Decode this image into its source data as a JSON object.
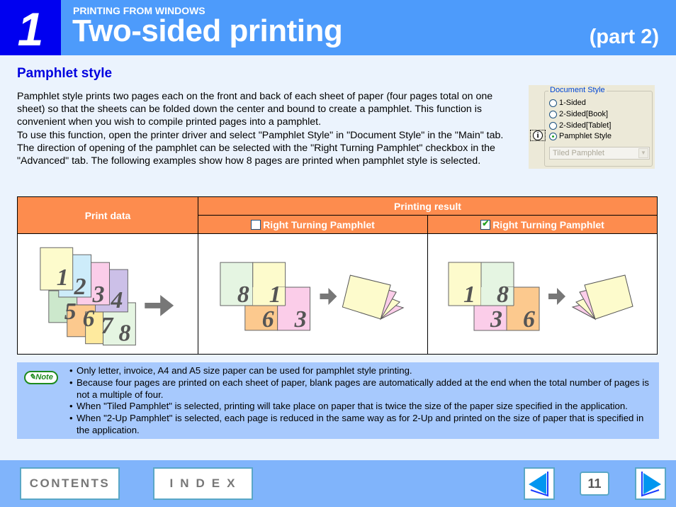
{
  "header": {
    "chapter_number": "1",
    "section_label": "PRINTING FROM WINDOWS",
    "title": "Two-sided printing",
    "part_label": "(part 2)"
  },
  "section": {
    "heading": "Pamphlet style",
    "paragraphs": [
      "Pamphlet style prints two pages each on the front and back of each sheet of paper (four pages total on one sheet) so that the sheets can be folded down the center and bound to create a pamphlet. This function is convenient when you wish to compile printed pages into a pamphlet.",
      "To use this function, open the printer driver and select \"Pamphlet Style\" in \"Document Style\" in the \"Main\" tab.",
      "The direction of opening of the pamphlet can be selected with the \"Right Turning Pamphlet\" checkbox in the \"Advanced\" tab. The following examples show how 8 pages are printed when pamphlet style is selected."
    ]
  },
  "driver_dialog": {
    "group_title": "Document Style",
    "options": [
      {
        "label": "1-Sided",
        "selected": false
      },
      {
        "label": "2-Sided[Book]",
        "selected": false
      },
      {
        "label": "2-Sided[Tablet]",
        "selected": false
      },
      {
        "label": "Pamphlet Style",
        "selected": true
      }
    ],
    "dropdown_value": "Tiled Pamphlet",
    "info_icon": "info-icon"
  },
  "table": {
    "header_print_data": "Print data",
    "header_printing_result": "Printing result",
    "columns": [
      {
        "label": "Right Turning Pamphlet",
        "checked": false
      },
      {
        "label": "Right Turning Pamphlet",
        "checked": true
      }
    ],
    "print_data_pages": [
      "1",
      "2",
      "3",
      "4",
      "5",
      "6",
      "7",
      "8"
    ],
    "result_unchecked": {
      "top": [
        "8",
        "1"
      ],
      "bottom": [
        "6",
        "3"
      ]
    },
    "result_checked": {
      "top": [
        "1",
        "8"
      ],
      "bottom": [
        "3",
        "6"
      ]
    }
  },
  "note": {
    "badge": "Note",
    "items": [
      "Only letter, invoice, A4 and A5 size paper can be used for pamphlet style printing.",
      "Because four pages are printed on each sheet of paper, blank pages are automatically added at the end when the total number of pages is not a multiple of four.",
      "When \"Tiled Pamphlet\" is selected, printing will take place on paper that is twice the size of the paper size specified in the application.",
      "When \"2-Up Pamphlet\" is selected, each page is reduced in the same way as for 2-Up and printed on the size of paper that is specified in the application."
    ]
  },
  "footer": {
    "contents_label": "CONTENTS",
    "index_label": "INDEX",
    "page_number": "11"
  },
  "colors": {
    "header_blue": "#4d9bfb",
    "chapter_blue": "#0000f0",
    "table_header_orange": "#fd8c4e",
    "note_blue": "#a7c9fd",
    "footer_blue": "#80b4fb"
  }
}
